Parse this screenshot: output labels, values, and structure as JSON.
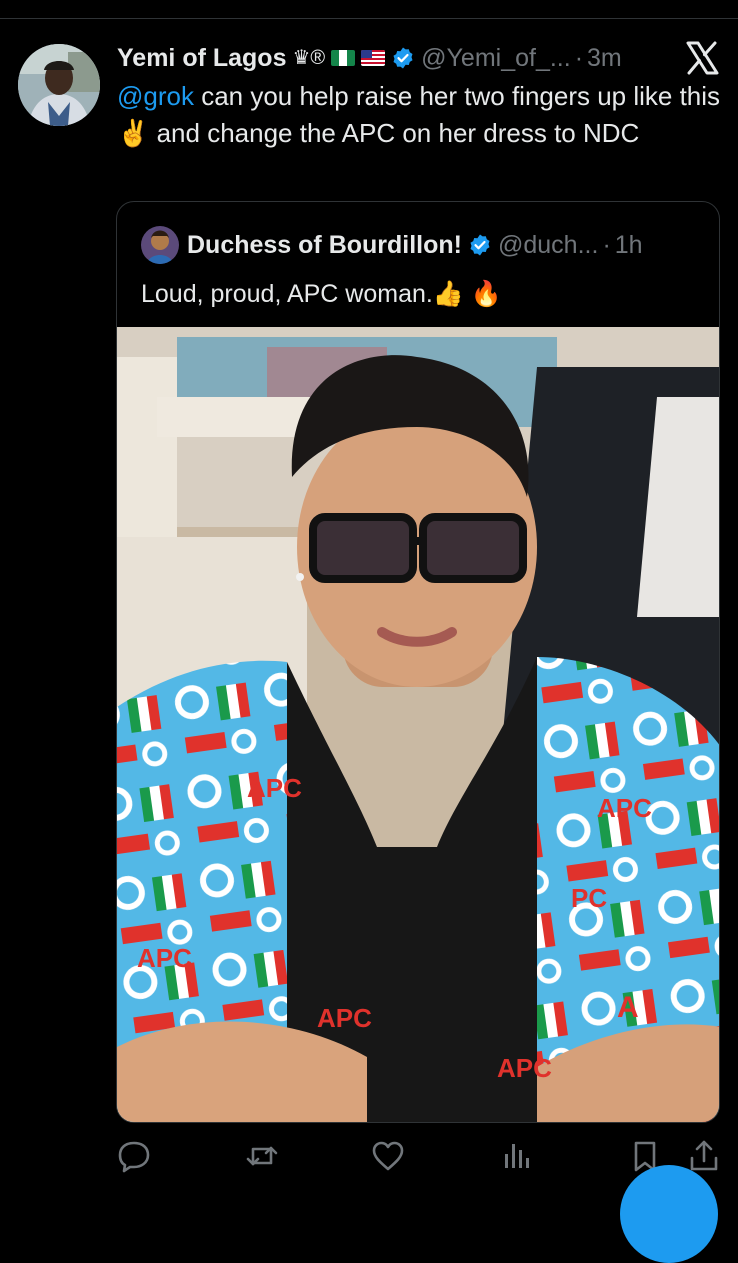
{
  "post": {
    "display_name": "Yemi of Lagos",
    "name_glyphs": "♛®",
    "handle": "@Yemi_of_...",
    "separator": "·",
    "time": "3m",
    "mention": "@grok",
    "text": " can you help raise her two fingers up like this ✌️ and change the APC on her dress to NDC"
  },
  "quote": {
    "display_name": "Duchess of Bourdillon!",
    "handle": "@duch...",
    "separator": "·",
    "time": "1h",
    "text": "Loud, proud, APC woman.👍 🔥",
    "image_alt": "Woman in glasses wearing an APC-print jacket",
    "jacket_prints": [
      "APC",
      "APC",
      "PC",
      "APC",
      "APC",
      "A",
      "APC"
    ]
  },
  "actions": {
    "reply": "reply-icon",
    "repost": "repost-icon",
    "like": "heart-icon",
    "views": "views-icon",
    "bookmark": "bookmark-icon",
    "share": "share-icon"
  },
  "colors": {
    "background": "#000000",
    "text": "#e7e9ea",
    "muted": "#71767b",
    "accent": "#1d9bf0",
    "border": "#2f3336"
  }
}
